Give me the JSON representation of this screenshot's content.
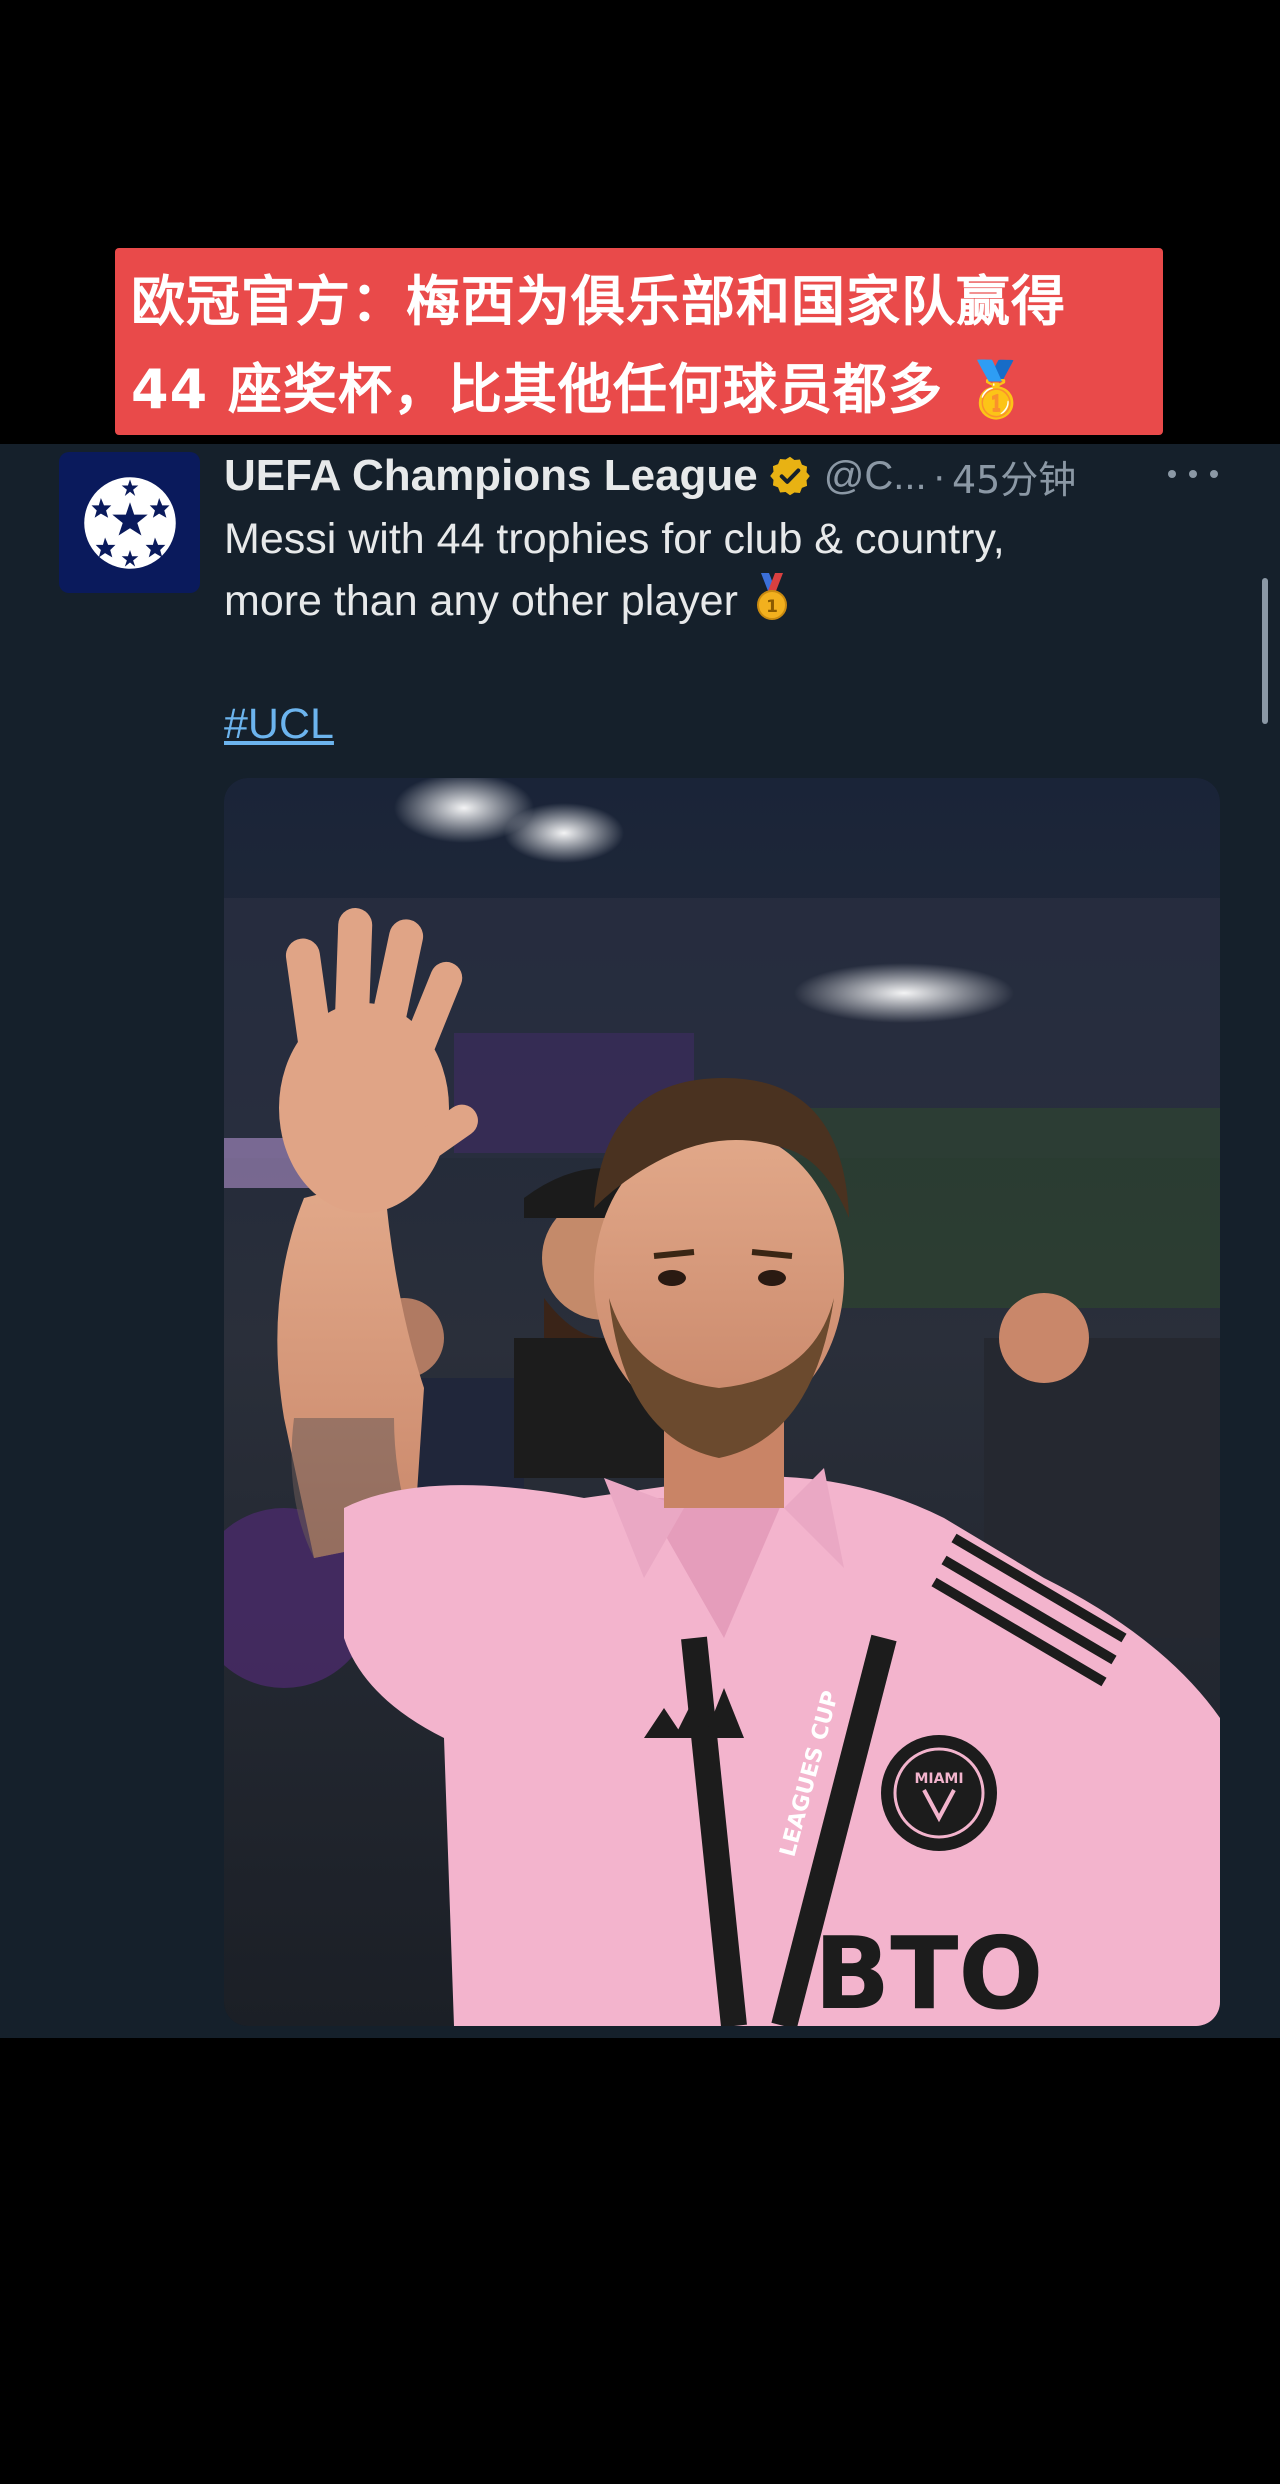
{
  "banner": {
    "line1": "欧冠官方：梅西为俱乐部和国家队赢得",
    "line2": "44 座奖杯，比其他任何球员都多 🥇"
  },
  "tweet": {
    "avatar_icon": "ucl-starball-icon",
    "display_name": "UEFA Champions League",
    "verified_icon": "verified-badge-icon",
    "handle": "@C...",
    "separator": "·",
    "time": "45分钟",
    "more_icon": "more-options-icon",
    "text_line1": "Messi with 44 trophies for club & country,",
    "text_line2": "more than any other player",
    "text_emoji": "medal-icon",
    "hashtag": "#UCL",
    "media_alt": "photo",
    "jersey": {
      "sponsor": "BTO",
      "badge_city": "MIAMI",
      "lanyard": "LEAGUES CUP"
    }
  },
  "colors": {
    "banner_bg": "#e94a4a",
    "panel_bg": "#15202b",
    "link": "#6cb4ee",
    "muted": "#8b98a5",
    "verified": "#e8b213",
    "jersey_pink": "#f3b4cd"
  }
}
